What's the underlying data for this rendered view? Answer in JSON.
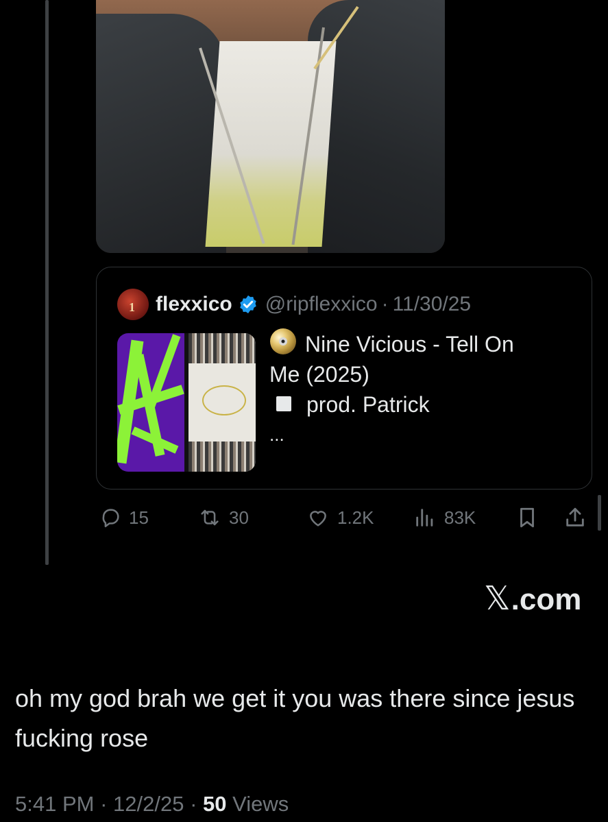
{
  "video": {
    "mute_icon": "speaker-muted-icon"
  },
  "quote": {
    "author_name": "flexxico",
    "verified_icon": "verified-badge-icon",
    "verified_color": "#1d9bf0",
    "handle": "@ripflexxico",
    "separator": "·",
    "date": "11/30/25",
    "text_line1": "Nine Vicious - Tell On",
    "text_line2": "Me (2025)",
    "text_line3": "prod. Patrick",
    "truncation": "...",
    "cd_icon": "optical-disc-icon",
    "square_icon": "white-square-icon",
    "thumbnail": "album-cover-image"
  },
  "actions": {
    "replies": "15",
    "reposts": "30",
    "likes": "1.2K",
    "views": "83K",
    "reply_icon": "reply-icon",
    "repost_icon": "repost-icon",
    "like_icon": "heart-icon",
    "views_icon": "analytics-icon",
    "bookmark_icon": "bookmark-icon",
    "share_icon": "share-icon"
  },
  "watermark": {
    "x": "𝕏",
    "domain": ".com"
  },
  "post": {
    "text": "oh my god brah we get it you was there since jesus fucking rose",
    "time": "5:41 PM",
    "separator": "·",
    "date": "12/2/25",
    "views_count": "50",
    "views_label": "Views"
  },
  "colors": {
    "background": "#000000",
    "text": "#e7e9ea",
    "muted": "#71767b",
    "border": "#2f3336"
  }
}
